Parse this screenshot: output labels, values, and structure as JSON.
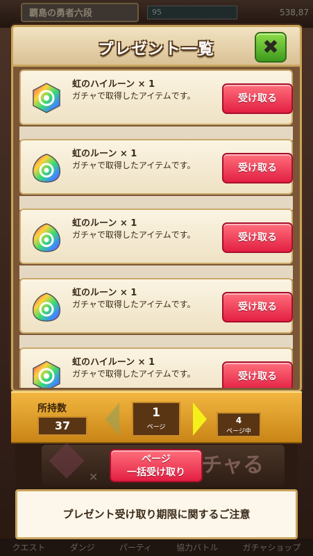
{
  "background": {
    "rank_title": "覇島の勇者六段",
    "bar_text": "95",
    "coins": "538,87",
    "gacha_text": "ガチャる",
    "bottom_nav": [
      "クエスト",
      "ダンジ",
      "パーティ",
      "協力バトル",
      "ガチャショップ"
    ]
  },
  "modal": {
    "title": "プレゼント一覧",
    "close_label": "✖"
  },
  "items": [
    {
      "name": "虹のハイルーン × 1",
      "desc": "ガチャで取得したアイテムです。",
      "button": "受け取る",
      "icon": "rainbow-high-rune-icon"
    },
    {
      "name": "虹のルーン × 1",
      "desc": "ガチャで取得したアイテムです。",
      "button": "受け取る",
      "icon": "rainbow-rune-icon"
    },
    {
      "name": "虹のルーン × 1",
      "desc": "ガチャで取得したアイテムです。",
      "button": "受け取る",
      "icon": "rainbow-rune-icon"
    },
    {
      "name": "虹のルーン × 1",
      "desc": "ガチャで取得したアイテムです。",
      "button": "受け取る",
      "icon": "rainbow-rune-icon"
    },
    {
      "name": "虹のハイルーン × 1",
      "desc": "ガチャで取得したアイテムです。",
      "button": "受け取る",
      "icon": "rainbow-high-rune-icon"
    }
  ],
  "pager": {
    "own_label": "所持数",
    "own_count": "37",
    "current_page": "1",
    "page_unit": "ページ",
    "total_pages": "4",
    "total_unit": "ページ中"
  },
  "bulk": {
    "line1": "ページ",
    "line2": "一括受け取り"
  },
  "notice": "プレゼント受け取り期限に関するご注意"
}
